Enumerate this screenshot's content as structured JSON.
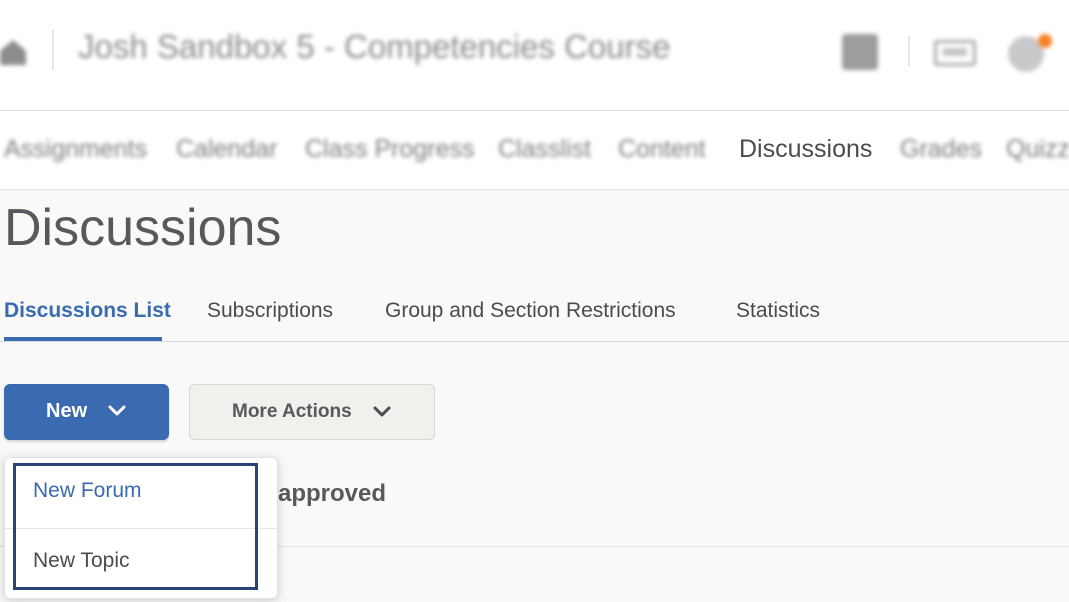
{
  "header": {
    "course_title": "Josh Sandbox 5 - Competencies Course",
    "icons": [
      "home-icon",
      "grid-icon",
      "mail-icon",
      "bell-icon"
    ],
    "notification_color": "#f57f25"
  },
  "nav": {
    "items": [
      {
        "label": "Assignments"
      },
      {
        "label": "Calendar"
      },
      {
        "label": "Class Progress"
      },
      {
        "label": "Classlist"
      },
      {
        "label": "Content"
      },
      {
        "label": "Discussions"
      },
      {
        "label": "Grades"
      },
      {
        "label": "Quizz"
      }
    ],
    "active": "Discussions"
  },
  "page": {
    "title": "Discussions"
  },
  "tabs": {
    "items": [
      {
        "label": "Discussions List"
      },
      {
        "label": "Subscriptions"
      },
      {
        "label": "Group and Section Restrictions"
      },
      {
        "label": "Statistics"
      }
    ],
    "active": "Discussions List",
    "accent_color": "#3a6ab0"
  },
  "toolbar": {
    "new_label": "New",
    "more_actions_label": "More Actions"
  },
  "dropdown": {
    "items": [
      {
        "label": "New Forum"
      },
      {
        "label": "New Topic"
      }
    ]
  },
  "content": {
    "partial_text": "approved"
  }
}
